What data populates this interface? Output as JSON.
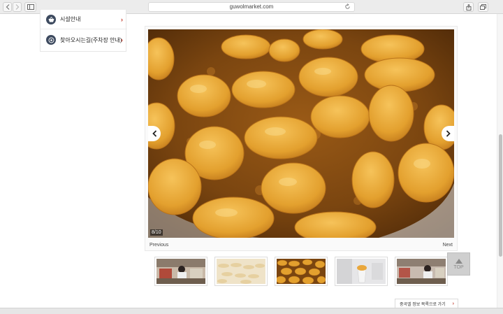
{
  "browser": {
    "url": "guwolmarket.com",
    "icons": {
      "back": "chevron-left-icon",
      "forward": "chevron-right-icon",
      "sidebar": "sidebar-icon",
      "reload": "reload-icon",
      "share": "share-icon",
      "tabs": "tabs-icon"
    }
  },
  "side_menu": {
    "items": [
      {
        "label": "시설안내",
        "icon": "basket-icon",
        "arrow": "›"
      },
      {
        "label": "찾아오시는길(주차장 안내)",
        "icon": "location-icon",
        "arrow": "›"
      }
    ]
  },
  "gallery": {
    "counter": "8/10",
    "prev_label": "Previous",
    "next_label": "Next",
    "image_subject": "fried twisted doughnuts in oil",
    "thumbnails": [
      {
        "subject": "vendor at market stall"
      },
      {
        "subject": "dough pieces on tray"
      },
      {
        "subject": "fried doughnuts",
        "active": true
      },
      {
        "subject": "cup of food"
      },
      {
        "subject": "vendor at market stall"
      }
    ]
  },
  "top_button": {
    "label": "TOP"
  },
  "bottom_link": {
    "label": "중곡엘 정보 목록으로 가기",
    "arrow": "›"
  },
  "colors": {
    "accent_arrow": "#c0392b",
    "menu_icon_bg": "#3d4a5f",
    "oil": "#7a4510",
    "doughnut": "#e3a02e"
  }
}
